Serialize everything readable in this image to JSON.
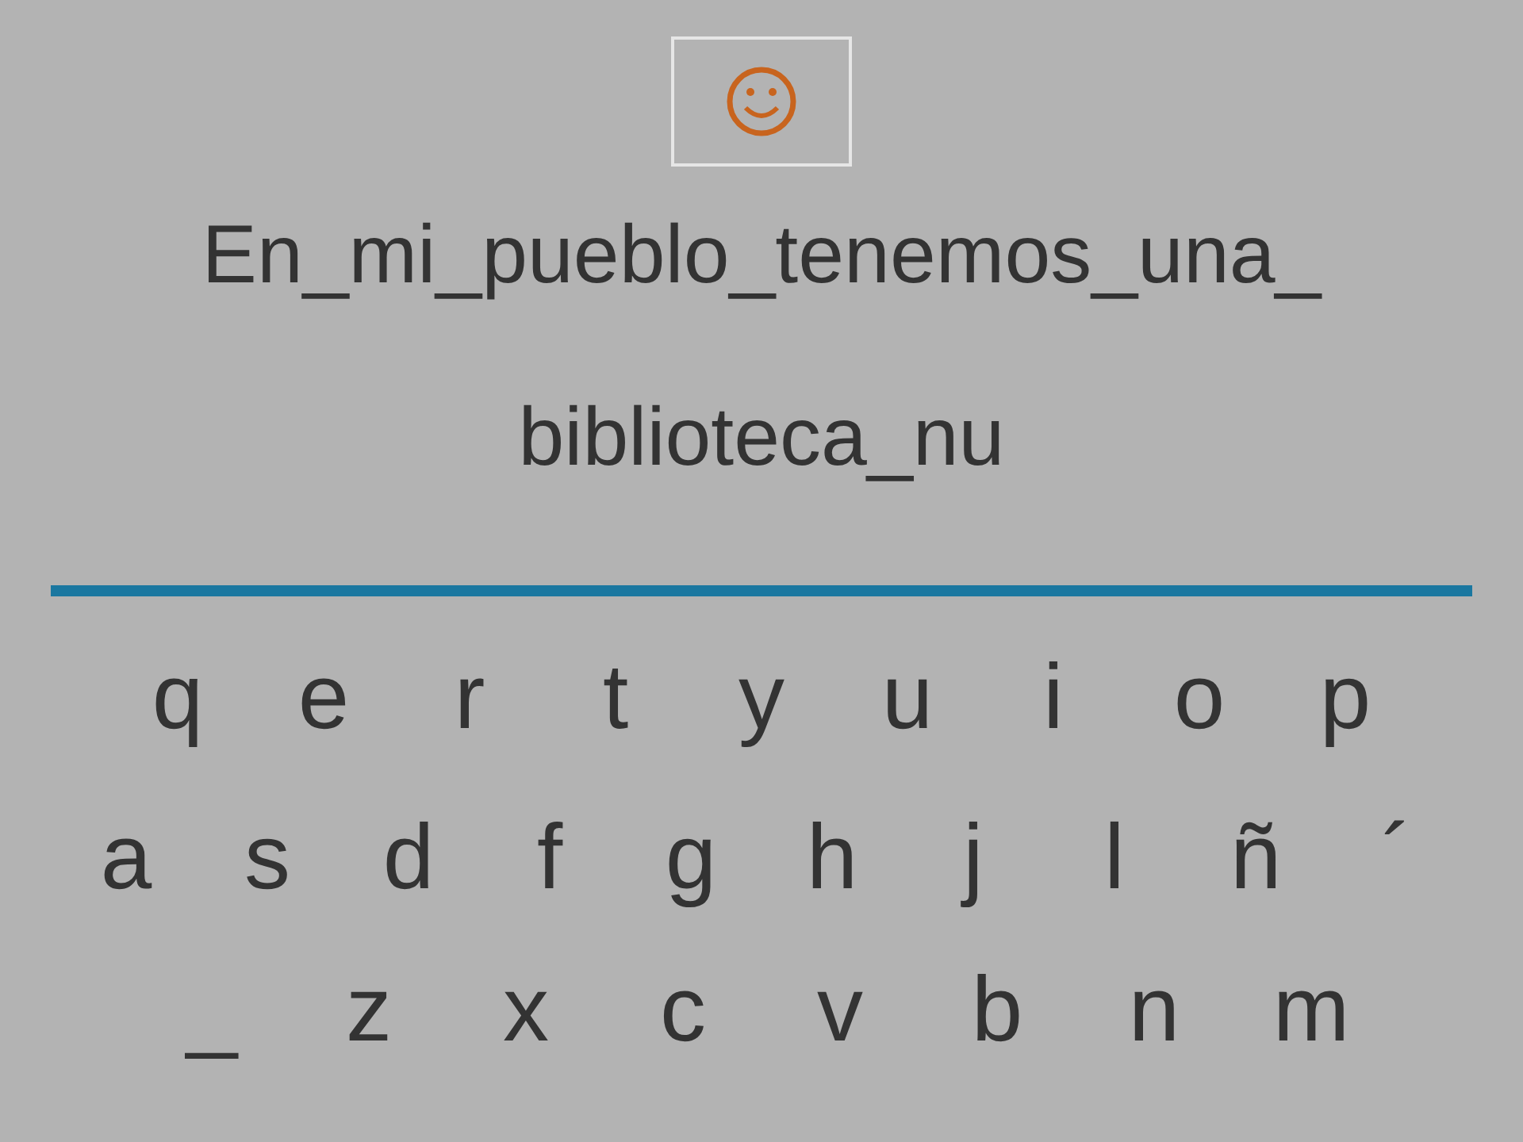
{
  "prompt_lines": [
    "En_mi_pueblo_tenemos_una_",
    "biblioteca_nu"
  ],
  "keyboard_rows": [
    [
      "q",
      "e",
      "r",
      "t",
      "y",
      "u",
      "i",
      "o",
      "p"
    ],
    [
      "a",
      "s",
      "d",
      "f",
      "g",
      "h",
      "j",
      "l",
      "ñ",
      "´"
    ],
    [
      "_",
      "z",
      "x",
      "c",
      "v",
      "b",
      "n",
      "m"
    ]
  ]
}
